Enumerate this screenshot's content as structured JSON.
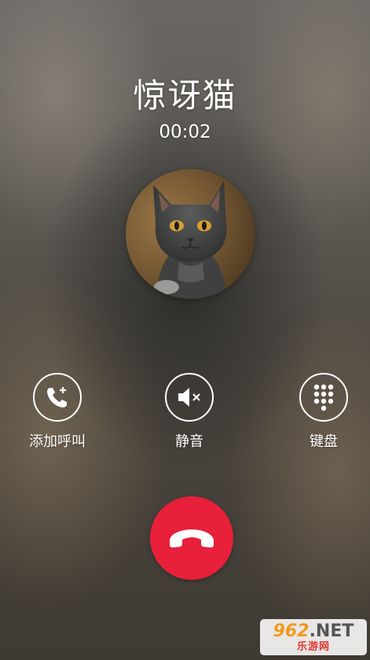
{
  "call": {
    "caller_name": "惊讶猫",
    "duration": "00:02"
  },
  "avatar": {
    "icon": "cat-photo-avatar"
  },
  "actions": {
    "add_call_label": "添加呼叫",
    "mute_label": "静音",
    "keypad_label": "键盘"
  },
  "end_call": {
    "icon": "hang-up-icon",
    "color": "#e8203a"
  },
  "watermark": {
    "brand_num": "962",
    "brand_suffix": ".NET",
    "subtitle": "乐游网"
  }
}
